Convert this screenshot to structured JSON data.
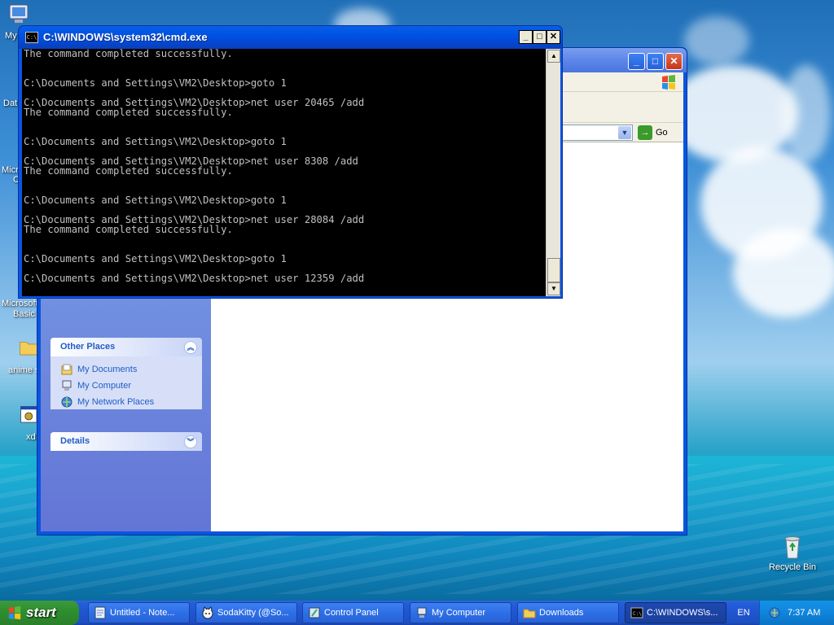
{
  "desktop": {
    "icons": [
      {
        "label": "My",
        "name": "my-documents"
      },
      {
        "label": "Dat",
        "name": "data"
      },
      {
        "label": "Micro",
        "name": "microsoft-1"
      },
      {
        "label": "C",
        "name": "microsoft-1b"
      },
      {
        "label": "Microsoft",
        "name": "microsoft-basic"
      },
      {
        "label": "Basic",
        "name": "microsoft-basic-2"
      },
      {
        "label": "anime s",
        "name": "anime"
      },
      {
        "label": "xd",
        "name": "xd"
      }
    ],
    "recycle_bin": "Recycle Bin"
  },
  "cmd": {
    "title": "C:\\WINDOWS\\system32\\cmd.exe",
    "lines": [
      "The command completed successfully.",
      "",
      "",
      "C:\\Documents and Settings\\VM2\\Desktop>goto 1",
      "",
      "C:\\Documents and Settings\\VM2\\Desktop>net user 20465 /add",
      "The command completed successfully.",
      "",
      "",
      "C:\\Documents and Settings\\VM2\\Desktop>goto 1",
      "",
      "C:\\Documents and Settings\\VM2\\Desktop>net user 8308 /add",
      "The command completed successfully.",
      "",
      "",
      "C:\\Documents and Settings\\VM2\\Desktop>goto 1",
      "",
      "C:\\Documents and Settings\\VM2\\Desktop>net user 28084 /add",
      "The command completed successfully.",
      "",
      "",
      "C:\\Documents and Settings\\VM2\\Desktop>goto 1",
      "",
      "C:\\Documents and Settings\\VM2\\Desktop>net user 12359 /add"
    ]
  },
  "explorer": {
    "go_label": "Go",
    "other_places": {
      "title": "Other Places",
      "items": [
        "My Documents",
        "My Computer",
        "My Network Places"
      ]
    },
    "details": {
      "title": "Details"
    }
  },
  "taskbar": {
    "start_label": "start",
    "buttons": [
      {
        "label": "Untitled - Note...",
        "icon": "notepad-icon"
      },
      {
        "label": "SodaKitty (@So...",
        "icon": "cat-icon"
      },
      {
        "label": "Control Panel",
        "icon": "control-panel-icon"
      },
      {
        "label": "My Computer",
        "icon": "computer-icon"
      },
      {
        "label": "Downloads",
        "icon": "folder-icon"
      },
      {
        "label": "C:\\WINDOWS\\s...",
        "icon": "cmd-icon"
      }
    ],
    "language": "EN",
    "clock": "7:37 AM"
  }
}
